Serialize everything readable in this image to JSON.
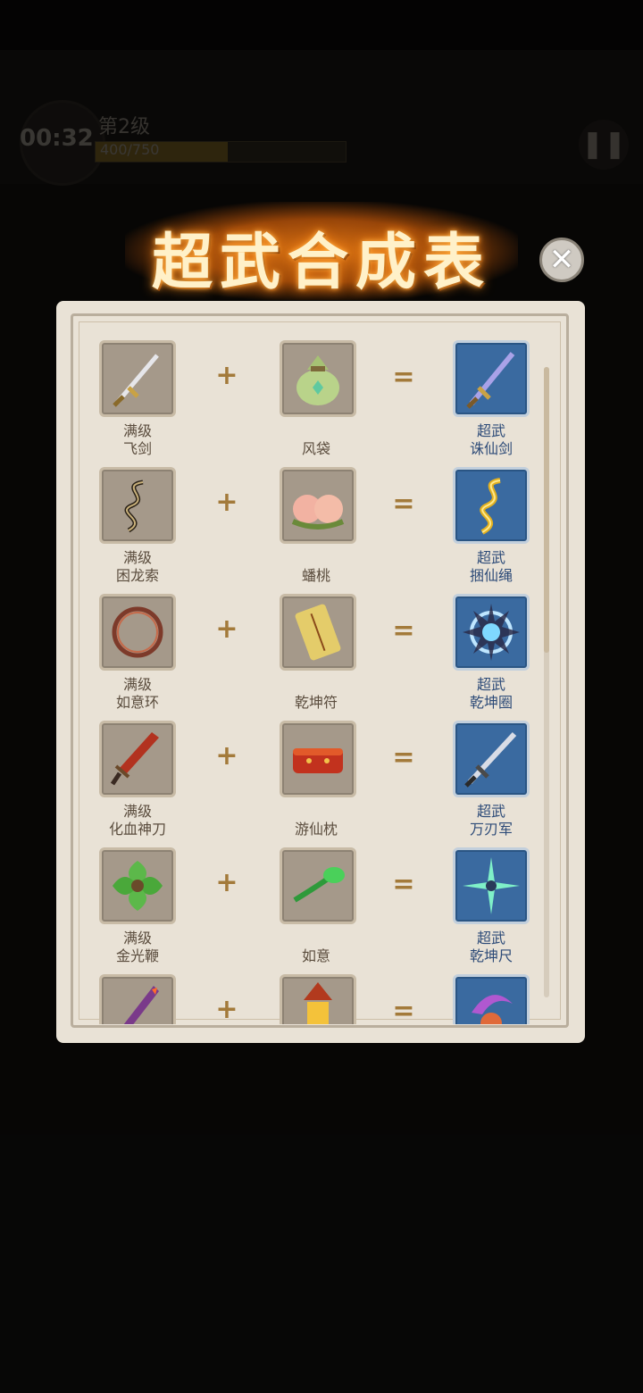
{
  "hud": {
    "timer": "00:32",
    "level": "第2级",
    "xp": "400/750",
    "xp_progress": 0.53,
    "pause_icon": "pause-icon"
  },
  "modal": {
    "title": "超武合成表",
    "close_icon": "close-icon",
    "scroll_position": 0.0
  },
  "recipes": [
    {
      "weapon": {
        "line1": "满级",
        "line2": "飞剑",
        "icon": "flying-sword-icon"
      },
      "item": {
        "name": "风袋",
        "icon": "wind-bag-icon"
      },
      "result": {
        "line1": "超武",
        "line2": "诛仙剑",
        "icon": "zhuxian-sword-icon"
      }
    },
    {
      "weapon": {
        "line1": "满级",
        "line2": "困龙索",
        "icon": "dragon-rope-icon"
      },
      "item": {
        "name": "蟠桃",
        "icon": "peach-icon"
      },
      "result": {
        "line1": "超武",
        "line2": "捆仙绳",
        "icon": "immortal-rope-icon"
      }
    },
    {
      "weapon": {
        "line1": "满级",
        "line2": "如意环",
        "icon": "ring-icon"
      },
      "item": {
        "name": "乾坤符",
        "icon": "talisman-scroll-icon"
      },
      "result": {
        "line1": "超武",
        "line2": "乾坤圈",
        "icon": "qiankun-circle-icon"
      }
    },
    {
      "weapon": {
        "line1": "满级",
        "line2": "化血神刀",
        "icon": "blood-blade-icon"
      },
      "item": {
        "name": "游仙枕",
        "icon": "pillow-icon"
      },
      "result": {
        "line1": "超武",
        "line2": "万刃军",
        "icon": "blade-army-icon"
      }
    },
    {
      "weapon": {
        "line1": "满级",
        "line2": "金光鞭",
        "icon": "shuriken-icon"
      },
      "item": {
        "name": "如意",
        "icon": "ruyi-scepter-icon"
      },
      "result": {
        "line1": "超武",
        "line2": "乾坤尺",
        "icon": "star-blade-icon"
      }
    },
    {
      "weapon": {
        "line1": "",
        "line2": "",
        "icon": "flame-blade-icon"
      },
      "item": {
        "name": "",
        "icon": "lantern-icon"
      },
      "result": {
        "line1": "",
        "line2": "",
        "icon": "crescent-orb-icon"
      }
    }
  ],
  "operators": {
    "plus": "+",
    "equals": "="
  }
}
